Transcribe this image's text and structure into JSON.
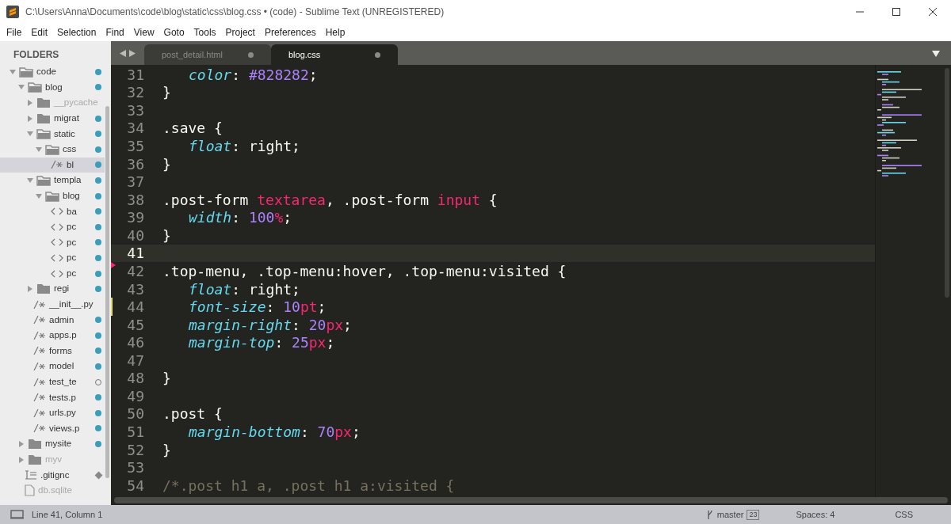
{
  "window": {
    "title": "C:\\Users\\Anna\\Documents\\code\\blog\\static\\css\\blog.css • (code) - Sublime Text (UNREGISTERED)"
  },
  "menu": [
    "File",
    "Edit",
    "Selection",
    "Find",
    "View",
    "Goto",
    "Tools",
    "Project",
    "Preferences",
    "Help"
  ],
  "sidebar": {
    "heading": "FOLDERS",
    "items": [
      {
        "name": "code",
        "kind": "folder",
        "expanded": true,
        "selected": false,
        "ignored": false,
        "badge": {
          "kind": "dot"
        },
        "children": [
          {
            "name": "blog",
            "kind": "folder",
            "expanded": true,
            "selected": false,
            "ignored": false,
            "badge": {
              "kind": "dot"
            },
            "children": [
              {
                "name": "__pycache",
                "kind": "folder",
                "expanded": false,
                "selected": false,
                "ignored": true
              },
              {
                "name": "migrat",
                "kind": "folder",
                "expanded": false,
                "selected": false,
                "ignored": false,
                "badge": {
                  "kind": "dot"
                }
              },
              {
                "name": "static",
                "kind": "folder",
                "expanded": true,
                "selected": false,
                "ignored": false,
                "badge": {
                  "kind": "dot"
                },
                "children": [
                  {
                    "name": "css",
                    "kind": "folder",
                    "expanded": true,
                    "selected": false,
                    "ignored": false,
                    "badge": {
                      "kind": "dot"
                    },
                    "children": [
                      {
                        "name": "bl",
                        "kind": "code",
                        "selected": true,
                        "ignored": false,
                        "badge": {
                          "kind": "dot"
                        }
                      }
                    ]
                  }
                ]
              },
              {
                "name": "templa",
                "kind": "folder",
                "expanded": true,
                "selected": false,
                "ignored": false,
                "badge": {
                  "kind": "dot"
                },
                "children": [
                  {
                    "name": "blog",
                    "kind": "folder",
                    "expanded": true,
                    "selected": false,
                    "ignored": false,
                    "badge": {
                      "kind": "dot"
                    },
                    "children": [
                      {
                        "name": "ba",
                        "kind": "markup",
                        "selected": false,
                        "ignored": false,
                        "badge": {
                          "kind": "dot"
                        }
                      },
                      {
                        "name": "pc",
                        "kind": "markup",
                        "selected": false,
                        "ignored": false,
                        "badge": {
                          "kind": "dot"
                        }
                      },
                      {
                        "name": "pc",
                        "kind": "markup",
                        "selected": false,
                        "ignored": false,
                        "badge": {
                          "kind": "dot"
                        }
                      },
                      {
                        "name": "pc",
                        "kind": "markup",
                        "selected": false,
                        "ignored": false,
                        "badge": {
                          "kind": "dot"
                        }
                      },
                      {
                        "name": "pc",
                        "kind": "markup",
                        "selected": false,
                        "ignored": false,
                        "badge": {
                          "kind": "dot"
                        }
                      }
                    ]
                  }
                ]
              },
              {
                "name": "regi",
                "kind": "folder",
                "expanded": false,
                "selected": false,
                "ignored": false,
                "badge": {
                  "kind": "dot"
                }
              },
              {
                "name": "__init__.py",
                "kind": "code",
                "selected": false,
                "ignored": false
              },
              {
                "name": "admin",
                "kind": "code",
                "selected": false,
                "ignored": false,
                "badge": {
                  "kind": "dot"
                }
              },
              {
                "name": "apps.p",
                "kind": "code",
                "selected": false,
                "ignored": false,
                "badge": {
                  "kind": "dot"
                }
              },
              {
                "name": "forms",
                "kind": "code",
                "selected": false,
                "ignored": false,
                "badge": {
                  "kind": "dot"
                }
              },
              {
                "name": "model",
                "kind": "code",
                "selected": false,
                "ignored": false,
                "badge": {
                  "kind": "dot"
                }
              },
              {
                "name": "test_te",
                "kind": "code",
                "selected": false,
                "ignored": false,
                "badge": {
                  "kind": "ring"
                }
              },
              {
                "name": "tests.p",
                "kind": "code",
                "selected": false,
                "ignored": false,
                "badge": {
                  "kind": "dot"
                }
              },
              {
                "name": "urls.py",
                "kind": "code",
                "selected": false,
                "ignored": false,
                "badge": {
                  "kind": "dot"
                }
              },
              {
                "name": "views.p",
                "kind": "code",
                "selected": false,
                "ignored": false,
                "badge": {
                  "kind": "dot"
                }
              }
            ]
          },
          {
            "name": "mysite",
            "kind": "folder",
            "expanded": false,
            "selected": false,
            "ignored": false,
            "badge": {
              "kind": "dot"
            }
          },
          {
            "name": "myv",
            "kind": "folder",
            "expanded": false,
            "selected": false,
            "ignored": true
          },
          {
            "name": ".gitignc",
            "kind": "text",
            "selected": false,
            "ignored": false,
            "badge": {
              "kind": "diamond"
            }
          },
          {
            "name": "db.sqlite",
            "kind": "plain",
            "selected": false,
            "ignored": true
          }
        ]
      }
    ]
  },
  "tabs": [
    {
      "label": "post_detail.html",
      "selected": false
    },
    {
      "label": "blog.css",
      "selected": true
    }
  ],
  "editor": {
    "lines": [
      {
        "number": "31",
        "current": false,
        "indented": true,
        "tokens": [
          {
            "kind": "prop",
            "t": "color"
          },
          {
            "kind": "punct",
            "t": ": "
          },
          {
            "kind": "num",
            "t": "#828282"
          },
          {
            "kind": "punct",
            "t": ";"
          }
        ]
      },
      {
        "number": "32",
        "current": false,
        "indented": false,
        "tokens": [
          {
            "kind": "punct",
            "t": "}"
          }
        ]
      },
      {
        "number": "33",
        "current": false
      },
      {
        "number": "34",
        "current": false,
        "indented": false,
        "tokens": [
          {
            "kind": "sel",
            "t": ".save"
          },
          {
            "kind": "punct",
            "t": " {"
          }
        ]
      },
      {
        "number": "35",
        "current": false,
        "indented": true,
        "tokens": [
          {
            "kind": "prop",
            "t": "float"
          },
          {
            "kind": "punct",
            "t": ": "
          },
          {
            "kind": "val",
            "t": "right"
          },
          {
            "kind": "punct",
            "t": ";"
          }
        ]
      },
      {
        "number": "36",
        "current": false,
        "indented": false,
        "tokens": [
          {
            "kind": "punct",
            "t": "}"
          }
        ]
      },
      {
        "number": "37",
        "current": false
      },
      {
        "number": "38",
        "current": false,
        "indented": false,
        "tokens": [
          {
            "kind": "sel",
            "t": ".post-form "
          },
          {
            "kind": "tag",
            "t": "textarea"
          },
          {
            "kind": "punct",
            "t": ", "
          },
          {
            "kind": "sel",
            "t": ".post-form "
          },
          {
            "kind": "tag",
            "t": "input"
          },
          {
            "kind": "punct",
            "t": " {"
          }
        ]
      },
      {
        "number": "39",
        "current": false,
        "indented": true,
        "tokens": [
          {
            "kind": "prop",
            "t": "width"
          },
          {
            "kind": "punct",
            "t": ": "
          },
          {
            "kind": "num",
            "t": "100"
          },
          {
            "kind": "unit",
            "t": "%"
          },
          {
            "kind": "punct",
            "t": ";"
          }
        ]
      },
      {
        "number": "40",
        "current": false,
        "indented": false,
        "tokens": [
          {
            "kind": "punct",
            "t": "}"
          }
        ]
      },
      {
        "number": "41",
        "current": true
      },
      {
        "number": "42",
        "current": false,
        "indented": false,
        "gutter": {
          "kind": "deleted"
        },
        "tokens": [
          {
            "kind": "sel",
            "t": ".top-menu"
          },
          {
            "kind": "punct",
            "t": ", "
          },
          {
            "kind": "sel",
            "t": ".top-menu"
          },
          {
            "kind": "punct",
            "t": ":hover, "
          },
          {
            "kind": "sel",
            "t": ".top-menu"
          },
          {
            "kind": "punct",
            "t": ":visited {"
          }
        ]
      },
      {
        "number": "43",
        "current": false,
        "indented": true,
        "tokens": [
          {
            "kind": "prop",
            "t": "float"
          },
          {
            "kind": "punct",
            "t": ": "
          },
          {
            "kind": "val",
            "t": "right"
          },
          {
            "kind": "punct",
            "t": ";"
          }
        ]
      },
      {
        "number": "44",
        "current": false,
        "indented": true,
        "gutter": {
          "kind": "modified"
        },
        "tokens": [
          {
            "kind": "prop",
            "t": "font-size"
          },
          {
            "kind": "punct",
            "t": ": "
          },
          {
            "kind": "num",
            "t": "10"
          },
          {
            "kind": "unit",
            "t": "pt"
          },
          {
            "kind": "punct",
            "t": ";"
          }
        ]
      },
      {
        "number": "45",
        "current": false,
        "indented": true,
        "tokens": [
          {
            "kind": "prop",
            "t": "margin-right"
          },
          {
            "kind": "punct",
            "t": ": "
          },
          {
            "kind": "num",
            "t": "20"
          },
          {
            "kind": "unit",
            "t": "px"
          },
          {
            "kind": "punct",
            "t": ";"
          }
        ]
      },
      {
        "number": "46",
        "current": false,
        "indented": true,
        "tokens": [
          {
            "kind": "prop",
            "t": "margin-top"
          },
          {
            "kind": "punct",
            "t": ": "
          },
          {
            "kind": "num",
            "t": "25"
          },
          {
            "kind": "unit",
            "t": "px"
          },
          {
            "kind": "punct",
            "t": ";"
          }
        ]
      },
      {
        "number": "47",
        "current": false
      },
      {
        "number": "48",
        "current": false,
        "indented": false,
        "tokens": [
          {
            "kind": "punct",
            "t": "}"
          }
        ]
      },
      {
        "number": "49",
        "current": false
      },
      {
        "number": "50",
        "current": false,
        "indented": false,
        "tokens": [
          {
            "kind": "sel",
            "t": ".post"
          },
          {
            "kind": "punct",
            "t": " {"
          }
        ]
      },
      {
        "number": "51",
        "current": false,
        "indented": true,
        "tokens": [
          {
            "kind": "prop",
            "t": "margin-bottom"
          },
          {
            "kind": "punct",
            "t": ": "
          },
          {
            "kind": "num",
            "t": "70"
          },
          {
            "kind": "unit",
            "t": "px"
          },
          {
            "kind": "punct",
            "t": ";"
          }
        ]
      },
      {
        "number": "52",
        "current": false,
        "indented": false,
        "tokens": [
          {
            "kind": "punct",
            "t": "}"
          }
        ]
      },
      {
        "number": "53",
        "current": false
      },
      {
        "number": "54",
        "current": false,
        "indented": false,
        "tokens": [
          {
            "kind": "comment",
            "t": "/*.post h1 a, .post h1 a:visited {"
          }
        ]
      }
    ]
  },
  "status_bar": {
    "position": "Line 41, Column 1",
    "branch": "master",
    "changes": "23",
    "indentation": "Spaces: 4",
    "syntax": "CSS"
  }
}
